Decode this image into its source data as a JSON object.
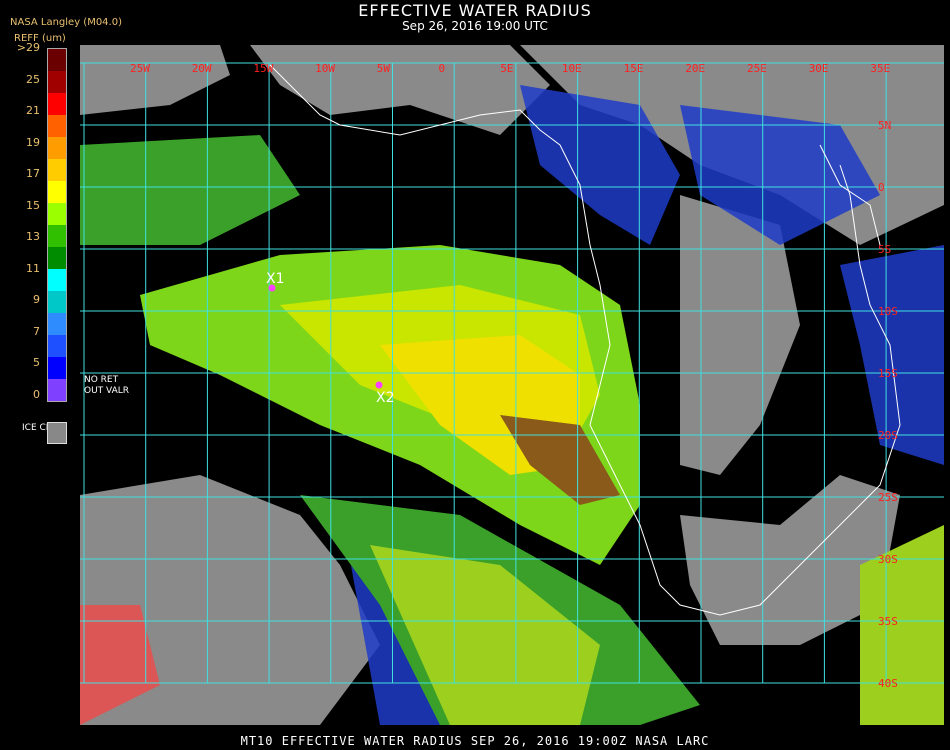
{
  "header": {
    "title": "EFFECTIVE WATER RADIUS",
    "subtitle": "Sep 26, 2016 19:00 UTC",
    "brand": "NASA Langley (M04.0)",
    "units": "REFF (um)"
  },
  "legend": {
    "ticks": [
      ">29",
      "25",
      "21",
      "19",
      "17",
      "15",
      "13",
      "11",
      "9",
      "7",
      "5",
      "0"
    ],
    "colors": [
      "#6a0000",
      "#a00000",
      "#ff0000",
      "#ff6000",
      "#ff9c00",
      "#ffcc00",
      "#ffff00",
      "#9cff00",
      "#30c000",
      "#008c00",
      "#00ffff",
      "#00c8c8",
      "#2e8cff",
      "#1e50ff",
      "#0000ff",
      "#8040ff"
    ],
    "ice_label": "ICE CLD",
    "ice_color": "#888888",
    "no_ret": "NO RET",
    "out_valr": "OUT VALR"
  },
  "map": {
    "lon_labels": [
      "25W",
      "20W",
      "15W",
      "10W",
      "5W",
      "0",
      "5E",
      "10E",
      "15E",
      "20E",
      "25E",
      "30E",
      "35E"
    ],
    "lat_labels": [
      "5N",
      "0",
      "5S",
      "10S",
      "15S",
      "20S",
      "25S",
      "30S",
      "35S",
      "40S"
    ],
    "markers": [
      "X1",
      "X2"
    ]
  },
  "footer": "MT10  EFFECTIVE WATER RADIUS  SEP 26, 2016 19:00Z  NASA LARC"
}
